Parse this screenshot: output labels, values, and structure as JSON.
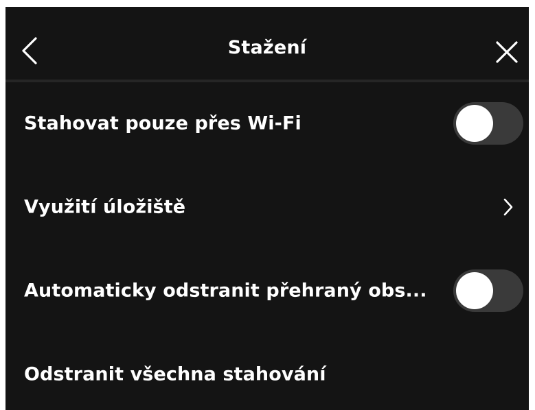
{
  "header": {
    "title": "Stažení",
    "back_icon": "chevron-left-icon",
    "close_icon": "close-icon"
  },
  "settings": [
    {
      "label": "Stahovat pouze přes Wi-Fi",
      "control": "toggle",
      "enabled": false
    },
    {
      "label": "Využití úložiště",
      "control": "chevron-right-icon"
    },
    {
      "label": "Automaticky odstranit přehraný obs...",
      "control": "toggle",
      "enabled": false
    },
    {
      "label": "Odstranit všechna stahování",
      "control": "none"
    }
  ],
  "colors": {
    "background": "#141414",
    "text": "#ffffff",
    "toggle_track_off": "#3a3a3a",
    "toggle_knob": "#ffffff",
    "divider": "#262626"
  }
}
